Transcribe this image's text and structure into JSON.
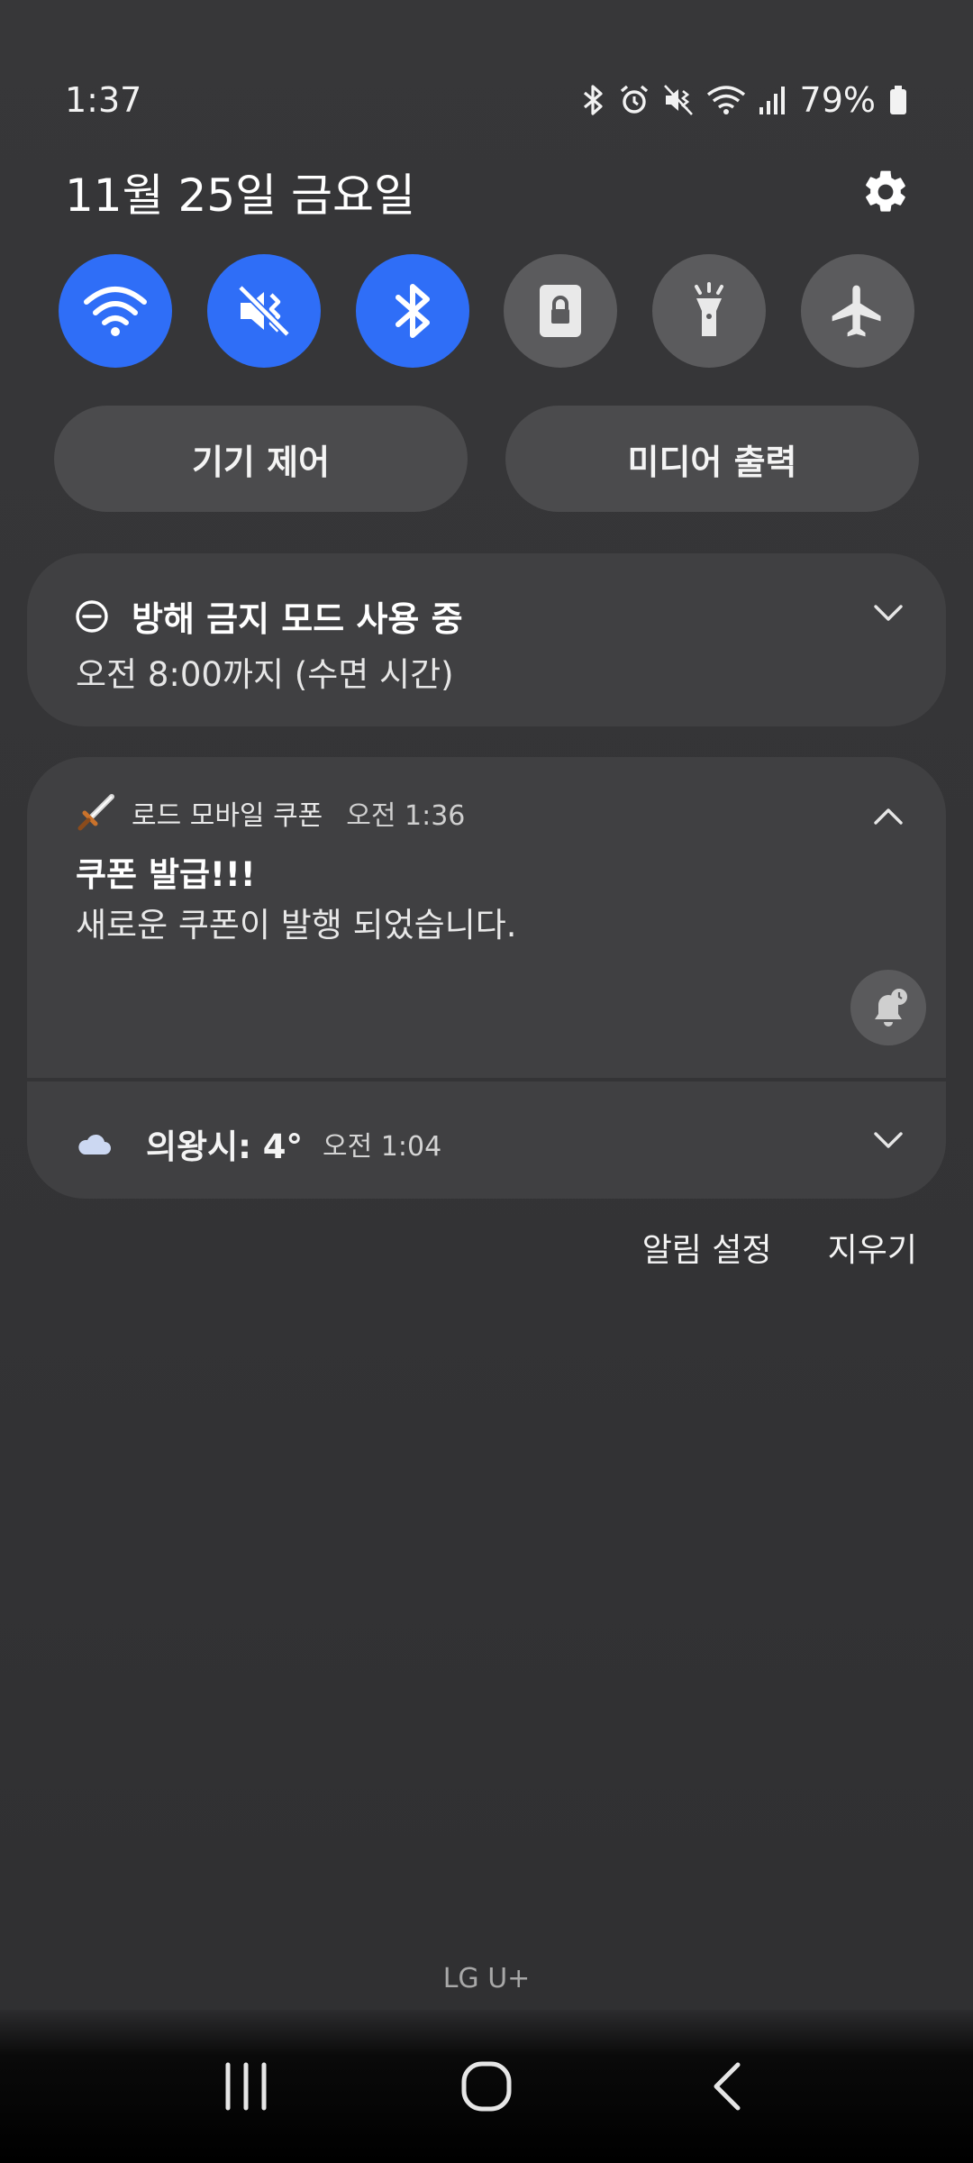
{
  "status_bar": {
    "time": "1:37",
    "battery": "79%",
    "icons": [
      "bluetooth-icon",
      "alarm-icon",
      "vibrate-mute-icon",
      "wifi-icon",
      "signal-icon",
      "battery-icon"
    ]
  },
  "header": {
    "date": "11월 25일 금요일"
  },
  "quick_toggles": [
    {
      "name": "wifi",
      "on": true
    },
    {
      "name": "mute",
      "on": true
    },
    {
      "name": "bluetooth",
      "on": true
    },
    {
      "name": "lock",
      "on": false
    },
    {
      "name": "flashlight",
      "on": false
    },
    {
      "name": "airplane",
      "on": false
    }
  ],
  "pills": {
    "device_control": "기기 제어",
    "media_output": "미디어 출력"
  },
  "dnd": {
    "title": "방해 금지 모드 사용 중",
    "subtitle": "오전 8:00까지 (수면 시간)"
  },
  "notification": {
    "app_name": "로드 모바일 쿠폰",
    "time": "오전 1:36",
    "title": "쿠폰 발급!!!",
    "body": "새로운 쿠폰이 발행 되었습니다."
  },
  "weather": {
    "city_temp": "의왕시: 4°",
    "time": "오전 1:04"
  },
  "actions": {
    "settings": "알림 설정",
    "clear": "지우기"
  },
  "carrier": "LG U+",
  "colors": {
    "accent": "#2f6ef7",
    "card": "#404042",
    "background": "#333335"
  }
}
